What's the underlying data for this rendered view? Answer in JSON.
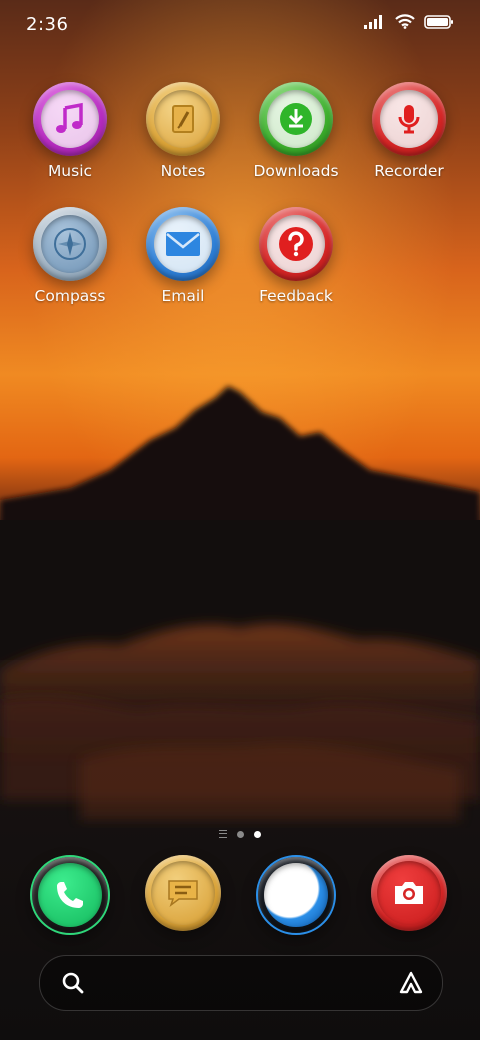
{
  "status_bar": {
    "time": "2:36",
    "icons": [
      "signal-icon",
      "wifi-icon",
      "battery-icon"
    ]
  },
  "home_apps": [
    {
      "label": "Music",
      "icon": "music-note-icon",
      "color": "#b52bbf"
    },
    {
      "label": "Notes",
      "icon": "notepad-icon",
      "color": "#d9a237"
    },
    {
      "label": "Downloads",
      "icon": "download-icon",
      "color": "#3cae2c"
    },
    {
      "label": "Recorder",
      "icon": "microphone-icon",
      "color": "#d52525"
    },
    {
      "label": "Compass",
      "icon": "compass-icon",
      "color": "#6b8aa6"
    },
    {
      "label": "Email",
      "icon": "envelope-icon",
      "color": "#2e7fd6"
    },
    {
      "label": "Feedback",
      "icon": "question-icon",
      "color": "#d52525"
    }
  ],
  "page_indicator": {
    "pages": 2,
    "active_page": 2
  },
  "dock_apps": [
    {
      "name": "Phone",
      "icon": "phone-icon",
      "color": "#1fc76a"
    },
    {
      "name": "Messages",
      "icon": "message-icon",
      "color": "#d9a237"
    },
    {
      "name": "Browser",
      "icon": "browser-icon",
      "color": "#2b8fe8"
    },
    {
      "name": "Camera",
      "icon": "camera-icon",
      "color": "#d52525"
    }
  ],
  "search_bar": {
    "placeholder": "",
    "left_icon": "search-icon",
    "right_icon": "assistant-icon"
  }
}
